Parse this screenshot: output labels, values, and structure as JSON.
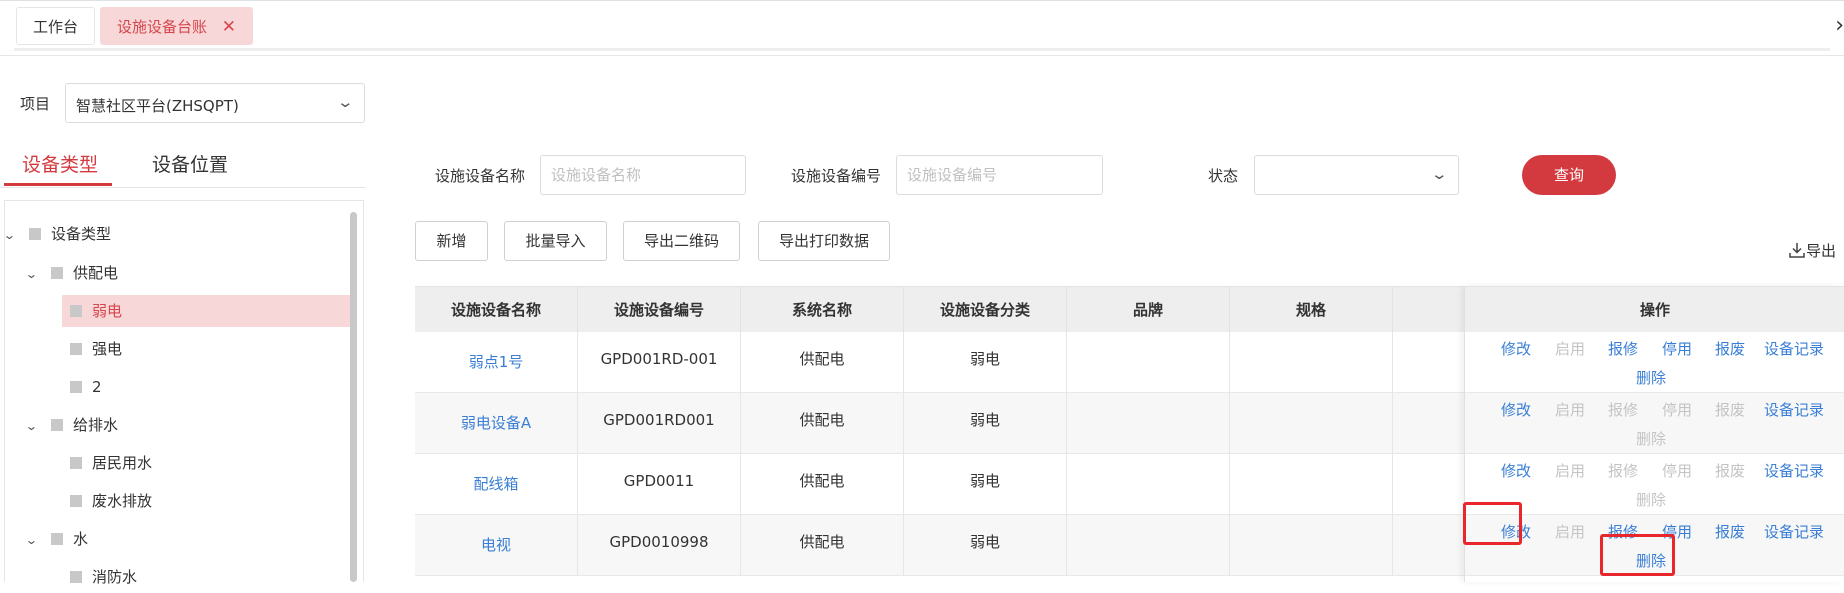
{
  "tabs": [
    {
      "label": "工作台",
      "active": false
    },
    {
      "label": "设施设备台账",
      "active": true,
      "close": "✕"
    }
  ],
  "project": {
    "label": "项目",
    "value": "智慧社区平台(ZHSQPT)"
  },
  "left_tabs": [
    {
      "label": "设备类型",
      "active": true
    },
    {
      "label": "设备位置",
      "active": false
    }
  ],
  "tree": [
    {
      "label": "设备类型",
      "level": 0,
      "expanded": true
    },
    {
      "label": "供配电",
      "level": 1,
      "expanded": true
    },
    {
      "label": "弱电",
      "level": 2,
      "selected": true
    },
    {
      "label": "强电",
      "level": 2
    },
    {
      "label": "2",
      "level": 2
    },
    {
      "label": "给排水",
      "level": 1,
      "expanded": true
    },
    {
      "label": "居民用水",
      "level": 2
    },
    {
      "label": "废水排放",
      "level": 2
    },
    {
      "label": "水",
      "level": 1,
      "expanded": true
    },
    {
      "label": "消防水",
      "level": 2
    }
  ],
  "search": {
    "name_label": "设施设备名称",
    "name_placeholder": "设施设备名称",
    "code_label": "设施设备编号",
    "code_placeholder": "设施设备编号",
    "status_label": "状态",
    "status_value": "",
    "query_label": "查询"
  },
  "toolbar": {
    "add": "新增",
    "batch_import": "批量导入",
    "export_qr": "导出二维码",
    "export_print": "导出打印数据",
    "export": "导出"
  },
  "table": {
    "columns": [
      "设施设备名称",
      "设施设备编号",
      "系统名称",
      "设施设备分类",
      "品牌",
      "规格",
      ""
    ],
    "op_header": "操作",
    "rows": [
      {
        "name": "弱点1号",
        "code": "GPD001RD-001",
        "system": "供配电",
        "category": "弱电",
        "brand": "",
        "spec": "",
        "ops": {
          "edit": true,
          "enable": false,
          "repair": true,
          "stop": true,
          "scrap": true,
          "record": true,
          "delete": true
        }
      },
      {
        "name": "弱电设备A",
        "code": "GPD001RD001",
        "system": "供配电",
        "category": "弱电",
        "brand": "",
        "spec": "",
        "ops": {
          "edit": true,
          "enable": false,
          "repair": false,
          "stop": false,
          "scrap": false,
          "record": true,
          "delete": false
        }
      },
      {
        "name": "配线箱",
        "code": "GPD0011",
        "system": "供配电",
        "category": "弱电",
        "brand": "",
        "spec": "",
        "ops": {
          "edit": true,
          "enable": false,
          "repair": false,
          "stop": false,
          "scrap": false,
          "record": true,
          "delete": false
        }
      },
      {
        "name": "电视",
        "code": "GPD0010998",
        "system": "供配电",
        "category": "弱电",
        "brand": "",
        "spec": "",
        "ops": {
          "edit": true,
          "enable": false,
          "repair": true,
          "stop": true,
          "scrap": true,
          "record": true,
          "delete": true
        }
      }
    ],
    "op_labels": {
      "edit": "修改",
      "enable": "启用",
      "repair": "报修",
      "stop": "停用",
      "scrap": "报废",
      "record": "设备记录",
      "delete": "删除"
    }
  },
  "colors": {
    "accent": "#d33a3f",
    "link": "#3a7fd5",
    "disabled": "#c4c4c4",
    "highlight": "#e8262c",
    "selected_bg": "#f8d7d9"
  },
  "icons": [
    "close-icon",
    "chevron-right-icon",
    "chevron-down-icon",
    "download-icon",
    "tree-expand-icon"
  ]
}
